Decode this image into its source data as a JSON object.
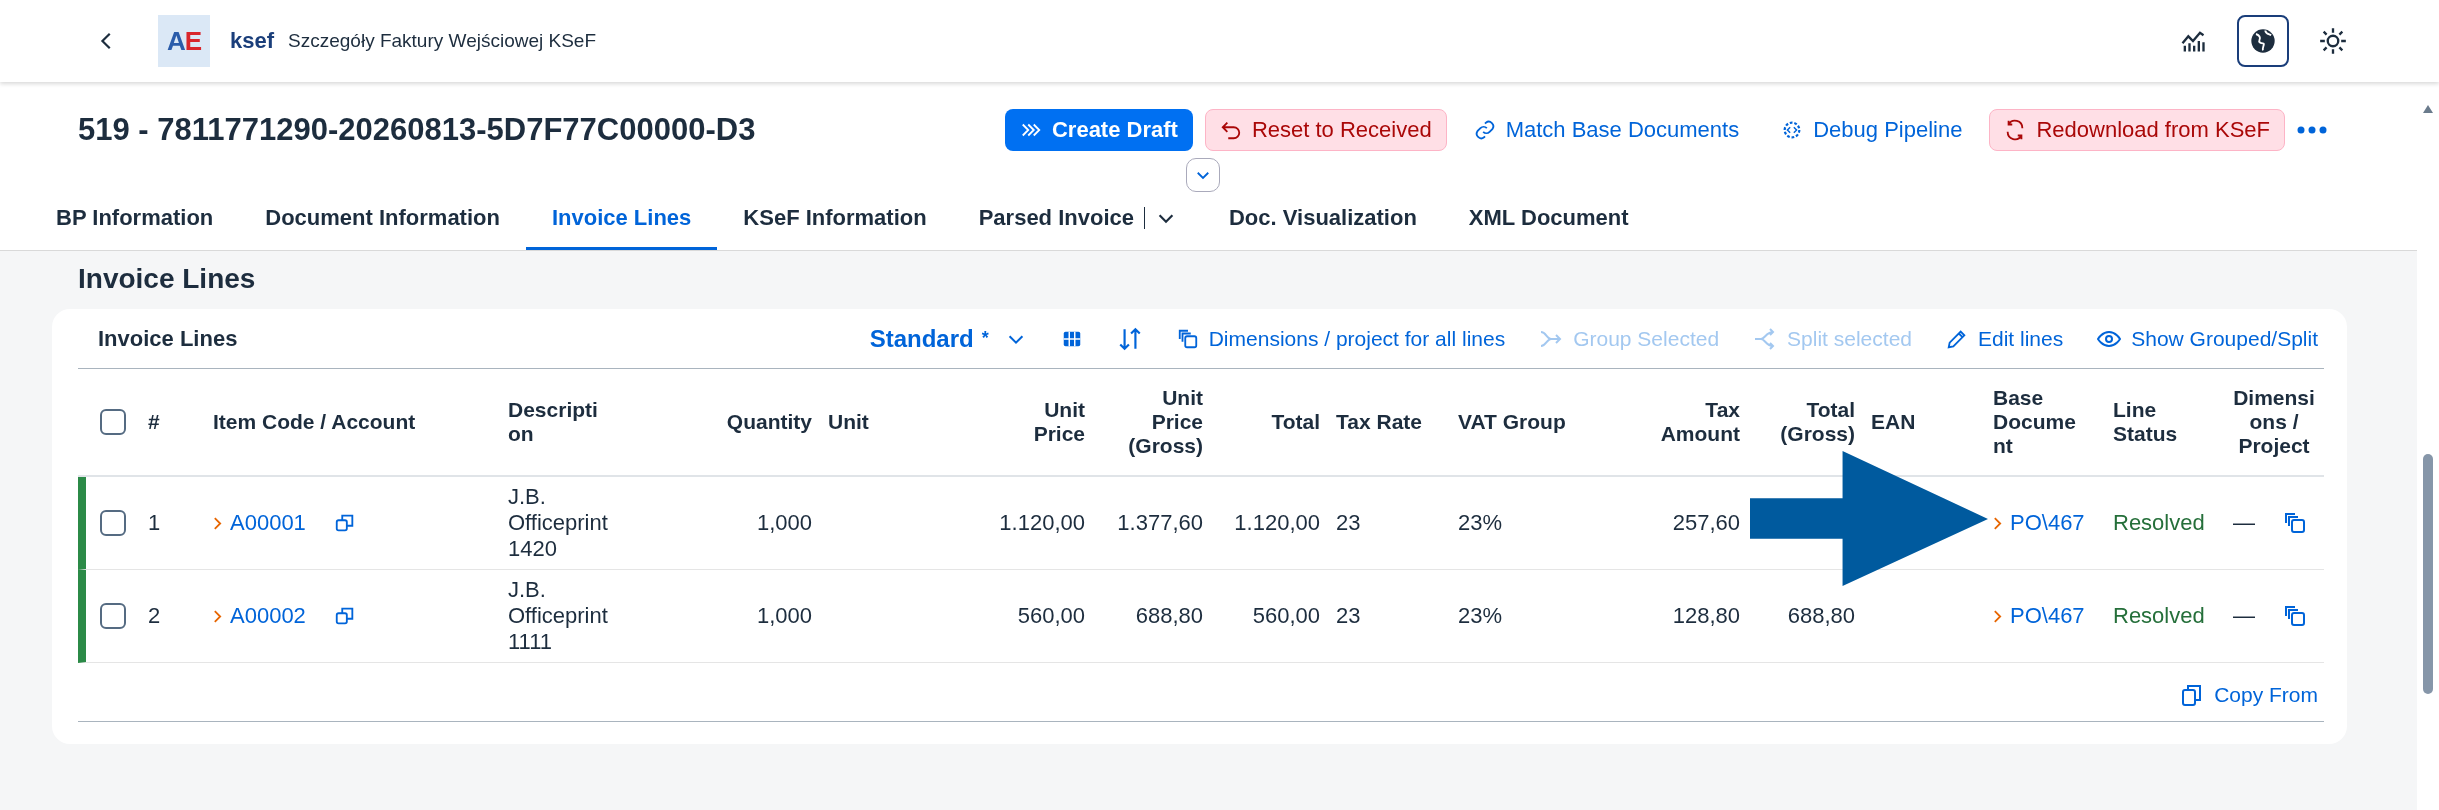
{
  "shell": {
    "logo": [
      {
        "text": "A",
        "color": "#2a5caa"
      },
      {
        "text": "E",
        "color": "#d9262c"
      }
    ],
    "app": "ksef",
    "title": "Szczegóły Faktury Wejściowej KSeF",
    "actions": [
      {
        "kind": "chart",
        "selected": false
      },
      {
        "kind": "globe",
        "selected": true
      },
      {
        "kind": "sun",
        "selected": false
      }
    ]
  },
  "header": {
    "title": "519 - 7811771290-20260813-5D7F77C00000-D3",
    "actions": [
      {
        "label": "Create Draft",
        "kind": "primary"
      },
      {
        "label": "Reset to Received",
        "kind": "negative"
      },
      {
        "label": "Match Base Documents",
        "kind": "link"
      },
      {
        "label": "Debug Pipeline",
        "kind": "link"
      },
      {
        "label": "Redownload from KSeF",
        "kind": "negative"
      }
    ]
  },
  "tabs": [
    {
      "label": "BP Information",
      "selected": false,
      "menu": false
    },
    {
      "label": "Document Information",
      "selected": false,
      "menu": false
    },
    {
      "label": "Invoice Lines",
      "selected": true,
      "menu": false
    },
    {
      "label": "KSeF Information",
      "selected": false,
      "menu": false
    },
    {
      "label": "Parsed Invoice",
      "selected": false,
      "menu": true
    },
    {
      "label": "Doc. Visualization",
      "selected": false,
      "menu": false
    },
    {
      "label": "XML Document",
      "selected": false,
      "menu": false
    }
  ],
  "section_title": "Invoice Lines",
  "table": {
    "title": "Invoice Lines",
    "variant": "Standard",
    "variant_marker": "*",
    "all_selected": false,
    "toolbar": [
      {
        "kind": "grid"
      },
      {
        "kind": "sort"
      },
      {
        "kind": "layers",
        "label": "Dimensions / project for all lines",
        "disabled": false
      },
      {
        "kind": "merge",
        "label": "Group Selected",
        "disabled": true
      },
      {
        "kind": "split",
        "label": "Split selected",
        "disabled": true
      },
      {
        "kind": "pencil",
        "label": "Edit lines",
        "disabled": false
      },
      {
        "kind": "eye",
        "label": "Show Grouped/Split",
        "disabled": false
      }
    ],
    "columns": [
      "#",
      "Item Code / Account",
      "Description",
      "Quantity",
      "Unit",
      "Unit Price",
      "Unit Price (Gross)",
      "Total",
      "Tax Rate",
      "VAT Group",
      "Tax Amount",
      "Total (Gross)",
      "EAN",
      "Base Document",
      "Line Status",
      "Dimensions / Project"
    ],
    "rows": [
      {
        "selected": false,
        "number": "1",
        "item_code": "A00001",
        "description": "J.B. Officeprint 1420",
        "quantity": "1,000",
        "unit_price": "1.120,00",
        "unit_price_gross": "1.377,60",
        "total": "1.120,00",
        "tax_rate": "23",
        "vat_group": "23%",
        "tax_amount": "257,60",
        "base_document": "PO\\467",
        "status": "Resolved",
        "dimensions": "—"
      },
      {
        "selected": false,
        "number": "2",
        "item_code": "A00002",
        "description": "J.B. Officeprint 1111",
        "quantity": "1,000",
        "unit_price": "560,00",
        "unit_price_gross": "688,80",
        "total": "560,00",
        "tax_rate": "23",
        "vat_group": "23%",
        "tax_amount": "128,80",
        "total_gross": "688,80",
        "base_document": "PO\\467",
        "status": "Resolved",
        "dimensions": "—"
      }
    ],
    "footer_action": "Copy From"
  }
}
